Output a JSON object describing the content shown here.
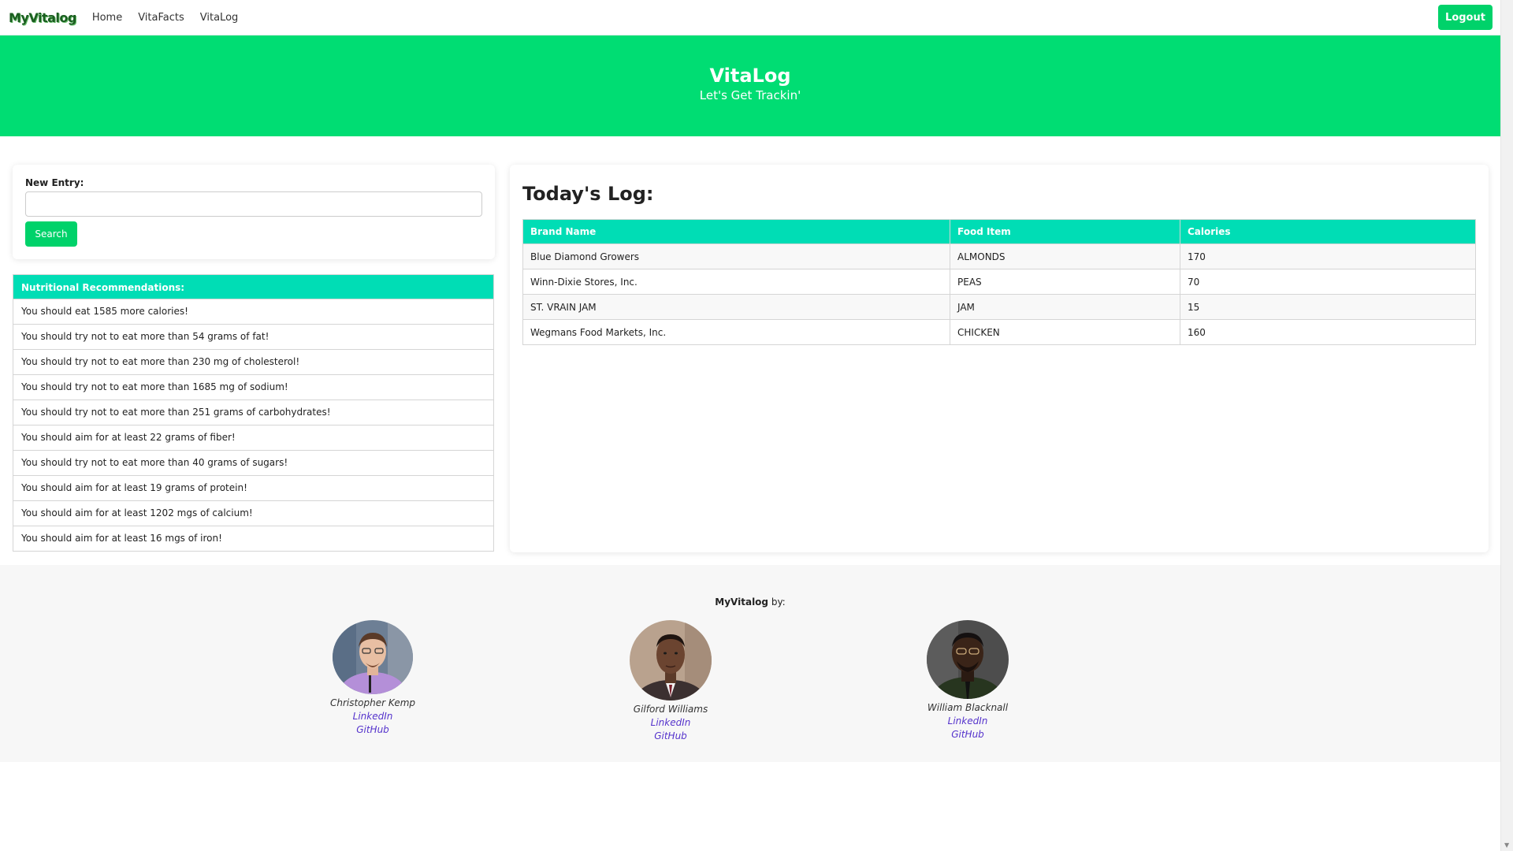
{
  "nav": {
    "logo": "MyVitalog",
    "links": [
      "Home",
      "VitaFacts",
      "VitaLog"
    ],
    "logout_label": "Logout"
  },
  "hero": {
    "title": "VitaLog",
    "subtitle": "Let's Get Trackin'"
  },
  "entry": {
    "label": "New Entry:",
    "placeholder": "",
    "value": "",
    "search_label": "Search"
  },
  "recommendations": {
    "header": "Nutritional Recommendations:",
    "items": [
      "You should eat 1585 more calories!",
      "You should try not to eat more than 54 grams of fat!",
      "You should try not to eat more than 230 mg of cholesterol!",
      "You should try not to eat more than 1685 mg of sodium!",
      "You should try not to eat more than 251 grams of carbohydrates!",
      "You should aim for at least 22 grams of fiber!",
      "You should try not to eat more than 40 grams of sugars!",
      "You should aim for at least 19 grams of protein!",
      "You should aim for at least 1202 mgs of calcium!",
      "You should aim for at least 16 mgs of iron!"
    ]
  },
  "log": {
    "title": "Today's Log:",
    "columns": [
      "Brand Name",
      "Food Item",
      "Calories"
    ],
    "rows": [
      [
        "Blue Diamond Growers",
        "ALMONDS",
        "170"
      ],
      [
        "Winn-Dixie Stores, Inc.",
        "PEAS",
        "70"
      ],
      [
        "ST. VRAIN JAM",
        "JAM",
        "15"
      ],
      [
        "Wegmans Food Markets, Inc.",
        "CHICKEN",
        "160"
      ]
    ]
  },
  "footer": {
    "brand": "MyVitalog",
    "by": " by:",
    "people": [
      {
        "name": "Christopher Kemp",
        "linkedin": "LinkedIn",
        "github": "GitHub"
      },
      {
        "name": "Gilford Williams",
        "linkedin": "LinkedIn",
        "github": "GitHub"
      },
      {
        "name": "William Blacknall",
        "linkedin": "LinkedIn",
        "github": "GitHub"
      }
    ]
  },
  "colors": {
    "primary_green": "#00dd73",
    "button_green": "#00d26a",
    "table_header_teal": "#00ddb5",
    "link_purple": "#5533cc"
  }
}
